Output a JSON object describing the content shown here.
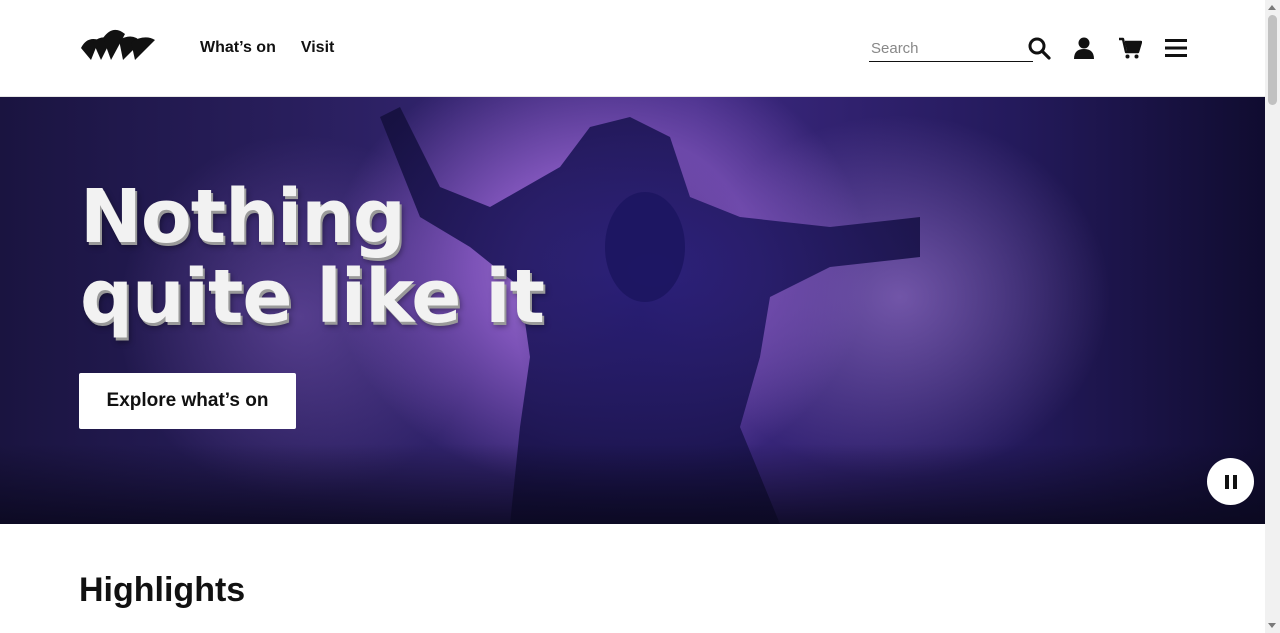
{
  "header": {
    "logo_alt": "Sydney Opera House",
    "nav": [
      {
        "label": "What’s on"
      },
      {
        "label": "Visit"
      }
    ],
    "search": {
      "placeholder": "Search",
      "value": ""
    },
    "icons": [
      "search-icon",
      "user-icon",
      "cart-icon",
      "menu-icon"
    ]
  },
  "hero": {
    "headline_line1": "Nothing",
    "headline_line2": "quite like it",
    "cta_label": "Explore what’s on",
    "pause_icon": "pause-icon",
    "accent": "#7d53b8"
  },
  "section": {
    "title": "Highlights"
  }
}
